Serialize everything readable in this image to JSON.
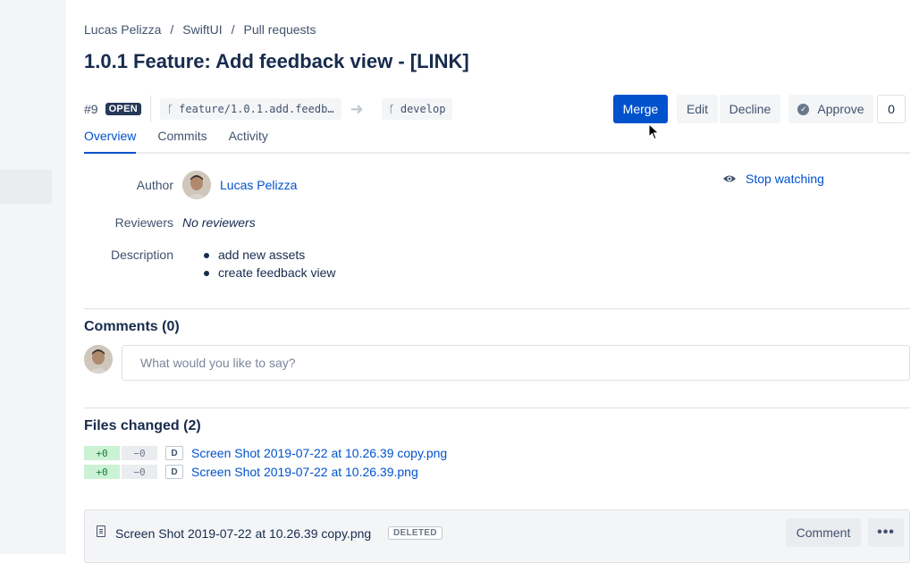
{
  "breadcrumb": {
    "items": [
      "Lucas Pelizza",
      "SwiftUI",
      "Pull requests"
    ],
    "separator": "/"
  },
  "title": "1.0.1 Feature: Add feedback view - [LINK]",
  "pr": {
    "number": "#9",
    "status": "OPEN",
    "source_branch": "feature/1.0.1.add.feedb…",
    "target_branch": "develop"
  },
  "actions": {
    "merge": "Merge",
    "edit": "Edit",
    "decline": "Decline",
    "approve": "Approve",
    "approve_count": "0"
  },
  "tabs": [
    {
      "label": "Overview",
      "active": true
    },
    {
      "label": "Commits",
      "active": false
    },
    {
      "label": "Activity",
      "active": false
    }
  ],
  "details": {
    "author_label": "Author",
    "author_name": "Lucas Pelizza",
    "reviewers_label": "Reviewers",
    "reviewers_value": "No reviewers",
    "description_label": "Description",
    "description_items": [
      "add new assets",
      "create feedback view"
    ],
    "watch_label": "Stop watching"
  },
  "comments": {
    "title": "Comments (0)",
    "placeholder": "What would you like to say?"
  },
  "files": {
    "title": "Files changed (2)",
    "items": [
      {
        "added": "+0",
        "removed": "−0",
        "status": "D",
        "name": "Screen Shot 2019-07-22 at 10.26.39 copy.png"
      },
      {
        "added": "+0",
        "removed": "−0",
        "status": "D",
        "name": "Screen Shot 2019-07-22 at 10.26.39.png"
      }
    ]
  },
  "file_card": {
    "name": "Screen Shot 2019-07-22 at 10.26.39 copy.png",
    "badge": "DELETED",
    "comment_label": "Comment",
    "more_label": "•••"
  },
  "colors": {
    "primary": "#0052cc",
    "text": "#172b4d",
    "muted": "#42526e",
    "added_bg": "#cbf2d5",
    "sidebar_bg": "#f4f5f7"
  },
  "icons": {
    "branch": "branch-icon",
    "arrow": "arrow-right-icon",
    "approve": "check-circle-icon",
    "watch": "eye-icon",
    "file": "file-icon",
    "more": "more-icon"
  }
}
